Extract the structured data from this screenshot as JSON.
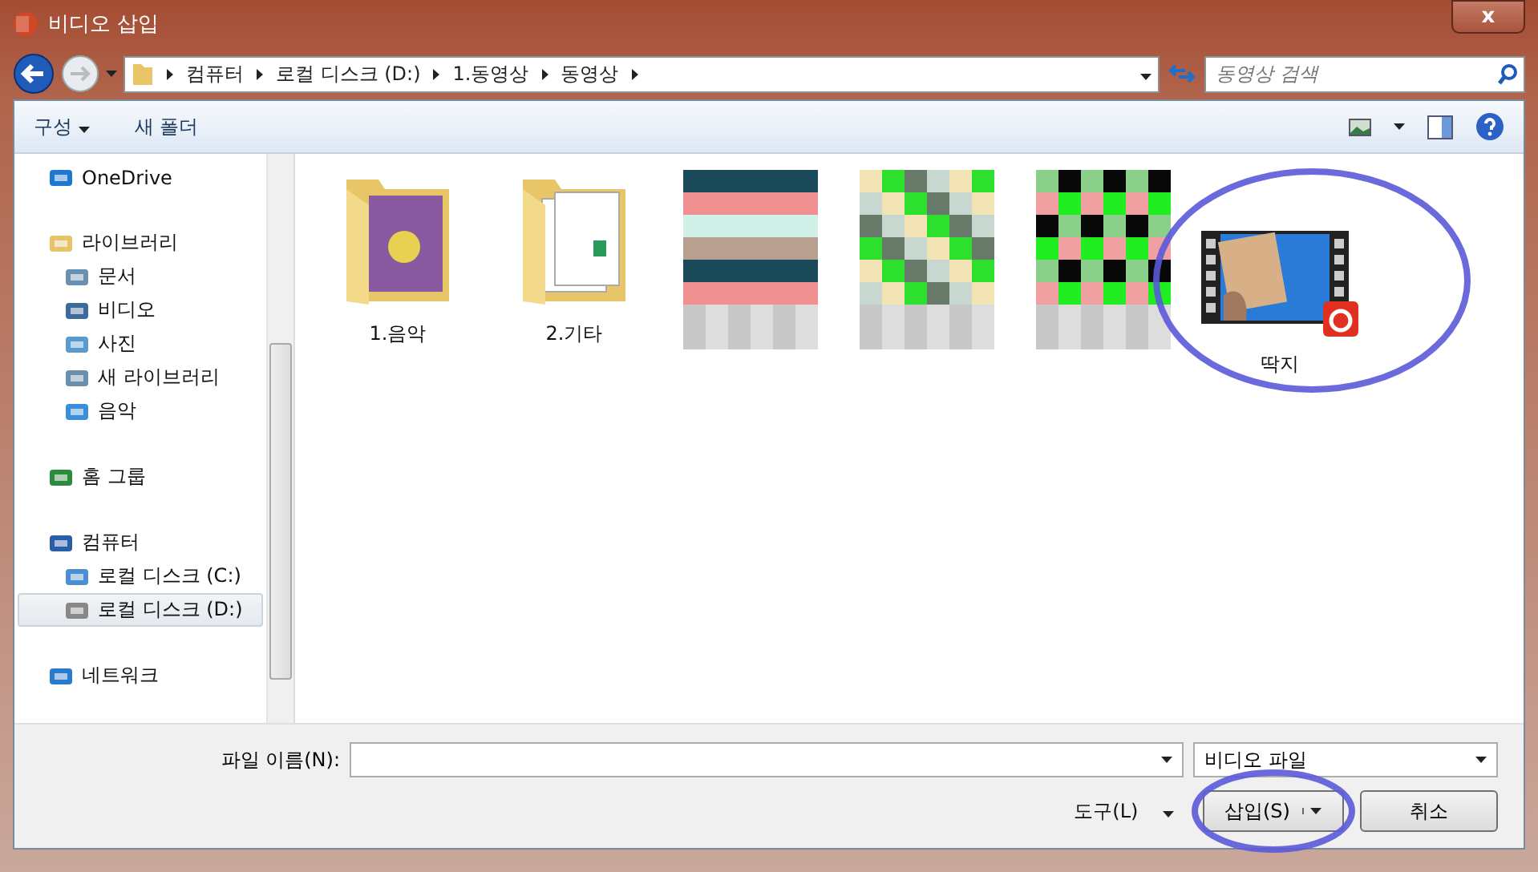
{
  "window": {
    "title": "비디오 삽입",
    "close": "x"
  },
  "address": {
    "crumbs": [
      "컴퓨터",
      "로컬 디스크 (D:)",
      "1.동영상",
      "동영상"
    ],
    "search_placeholder": "동영상 검색"
  },
  "toolbar": {
    "organize": "구성",
    "new_folder": "새 폴더"
  },
  "sidebar": {
    "items": [
      {
        "label": "OneDrive",
        "selected": false
      },
      {
        "label": "라이브러리",
        "selected": false,
        "children": [
          {
            "label": "문서",
            "selected": false
          },
          {
            "label": "비디오",
            "selected": false
          },
          {
            "label": "사진",
            "selected": false
          },
          {
            "label": "새 라이브러리",
            "selected": false
          },
          {
            "label": "음악",
            "selected": false
          }
        ]
      },
      {
        "label": "홈 그룹",
        "selected": false
      },
      {
        "label": "컴퓨터",
        "selected": false,
        "children": [
          {
            "label": "로컬 디스크 (C:)",
            "selected": false
          },
          {
            "label": "로컬 디스크 (D:)",
            "selected": true
          }
        ]
      },
      {
        "label": "네트워크",
        "selected": false
      }
    ]
  },
  "files": [
    {
      "kind": "folder",
      "name": "1.음악",
      "highlighted": false
    },
    {
      "kind": "folder",
      "name": "2.기타",
      "highlighted": false
    },
    {
      "kind": "picture",
      "highlighted": false
    },
    {
      "kind": "picture",
      "highlighted": false
    },
    {
      "kind": "picture",
      "highlighted": false
    },
    {
      "kind": "video",
      "name": "딱지",
      "highlighted": true
    }
  ],
  "footer": {
    "filename_label": "파일 이름(N):",
    "filetype": "비디오 파일",
    "tools": "도구(L)",
    "insert": "삽입(S)",
    "insert_highlighted": true,
    "cancel": "취소"
  }
}
